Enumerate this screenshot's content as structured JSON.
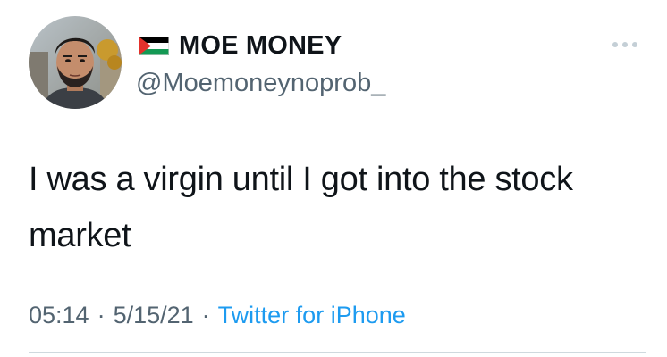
{
  "author": {
    "display_name": "MOE MONEY",
    "handle": "@Moemoneynoprob_",
    "flag_icon": "palestine-flag-icon",
    "avatar_icon": "profile-photo"
  },
  "tweet": {
    "text": "I was a virgin until I got into the stock market"
  },
  "meta": {
    "time": "05:14",
    "separator_1": "·",
    "date": "5/15/21",
    "separator_2": "·",
    "source": "Twitter for iPhone"
  },
  "actions": {
    "more_icon": "more-options-icon"
  },
  "colors": {
    "text_primary": "#0f1419",
    "text_secondary": "#536471",
    "link": "#1d9bf0",
    "divider": "#cfd9de"
  }
}
